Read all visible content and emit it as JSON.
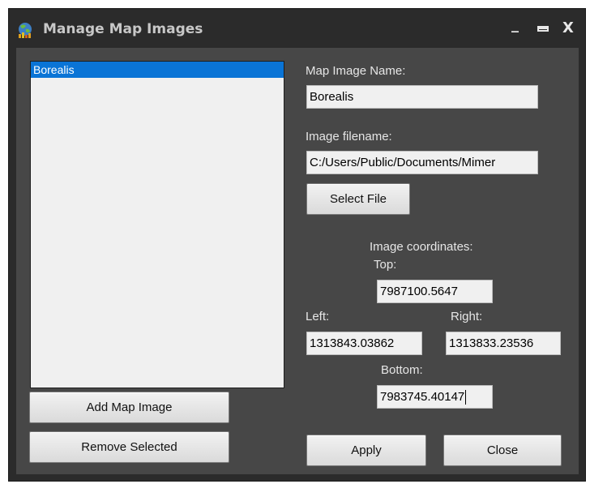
{
  "window": {
    "title": "Manage Map Images",
    "minimize_glyph": "_",
    "close_glyph": "X"
  },
  "icons": {
    "app": "map-globe-icon",
    "minimize": "minimize-icon",
    "maximize": "maximize-icon",
    "close": "close-icon"
  },
  "list": {
    "items": [
      "Borealis"
    ],
    "selected_index": 0
  },
  "form": {
    "map_name_label": "Map Image Name:",
    "map_name_value": "Borealis",
    "filename_label": "Image filename:",
    "filename_value": "C:/Users/Public/Documents/Mimer",
    "select_file_label": "Select File",
    "coords_label": "Image coordinates:",
    "top_label": "Top:",
    "top_value": "7987100.5647",
    "left_label": "Left:",
    "left_value": "1313843.03862",
    "right_label": "Right:",
    "right_value": "1313833.23536",
    "bottom_label": "Bottom:",
    "bottom_value": "7983745.40147"
  },
  "buttons": {
    "add": "Add Map Image",
    "remove": "Remove Selected",
    "apply": "Apply",
    "close": "Close"
  },
  "colors": {
    "selection": "#0a74d6",
    "window_bg": "#2b2b2b",
    "panel_bg": "#474747"
  }
}
